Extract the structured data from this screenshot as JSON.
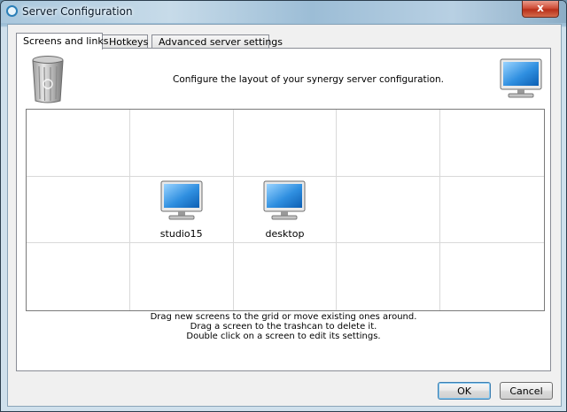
{
  "window": {
    "title": "Server Configuration",
    "close_label": "x"
  },
  "tabs": [
    {
      "label": "Screens and links",
      "active": true
    },
    {
      "label": "Hotkeys",
      "active": false
    },
    {
      "label": "Advanced server settings",
      "active": false
    }
  ],
  "panel": {
    "config_label": "Configure the layout of your synergy server configuration.",
    "grid": {
      "rows": 3,
      "cols": 5,
      "screens": [
        {
          "name": "studio15",
          "row": 1,
          "col": 1
        },
        {
          "name": "desktop",
          "row": 1,
          "col": 2
        }
      ]
    },
    "hints": [
      "Drag new screens to the grid or move existing ones around.",
      "Drag a screen to the trashcan to delete it.",
      "Double click on a screen to edit its settings."
    ]
  },
  "buttons": {
    "ok": "OK",
    "cancel": "Cancel"
  },
  "icons": {
    "trash": "trashcan-icon",
    "new_screen": "monitor-icon"
  },
  "colors": {
    "screen_blue": "#2f8fe0",
    "window_accent": "#8fb4cf"
  }
}
